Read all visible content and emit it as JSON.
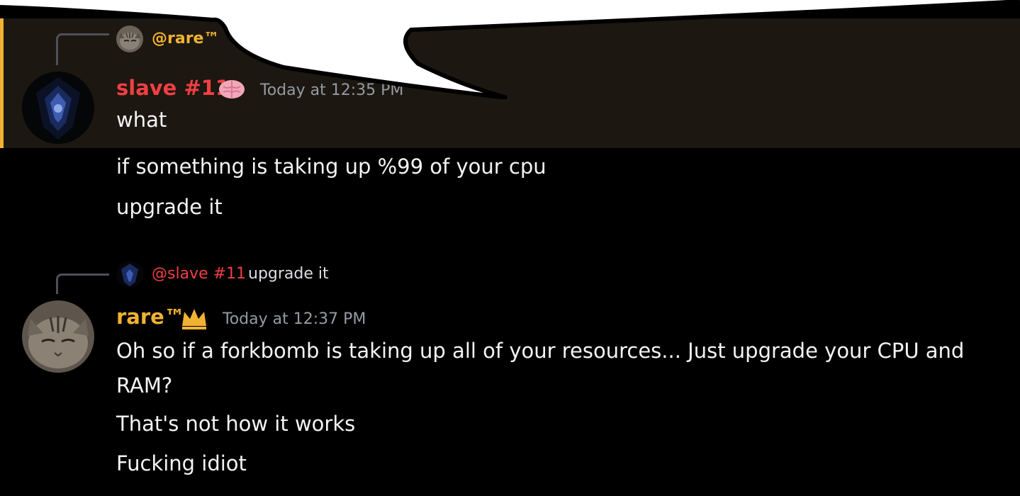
{
  "colors": {
    "slave_name": "#f23f43",
    "rare_name": "#f0b232",
    "highlight_bg": "#1c1710",
    "highlight_bar": "#f0b232",
    "timestamp": "#949ba4"
  },
  "message1": {
    "reply": {
      "mention": "@rare™",
      "avatar_icon": "cat-avatar-icon"
    },
    "author": "slave #11",
    "badge_icon": "brain-icon",
    "timestamp": "Today at 12:35 PM",
    "lines": [
      "what"
    ]
  },
  "followups": [
    "if something is taking up %99 of your cpu",
    "upgrade it"
  ],
  "message2": {
    "reply": {
      "mention": "@slave #11",
      "text": "upgrade it",
      "avatar_icon": "dark-avatar-icon"
    },
    "author": "rare™",
    "badge_icon": "crown-icon",
    "timestamp": "Today at 12:37 PM",
    "lines": [
      "Oh so if a forkbomb is taking up all of your resources... Just upgrade your CPU and RAM?",
      "That's not how it works",
      "Fucking idiot"
    ]
  }
}
